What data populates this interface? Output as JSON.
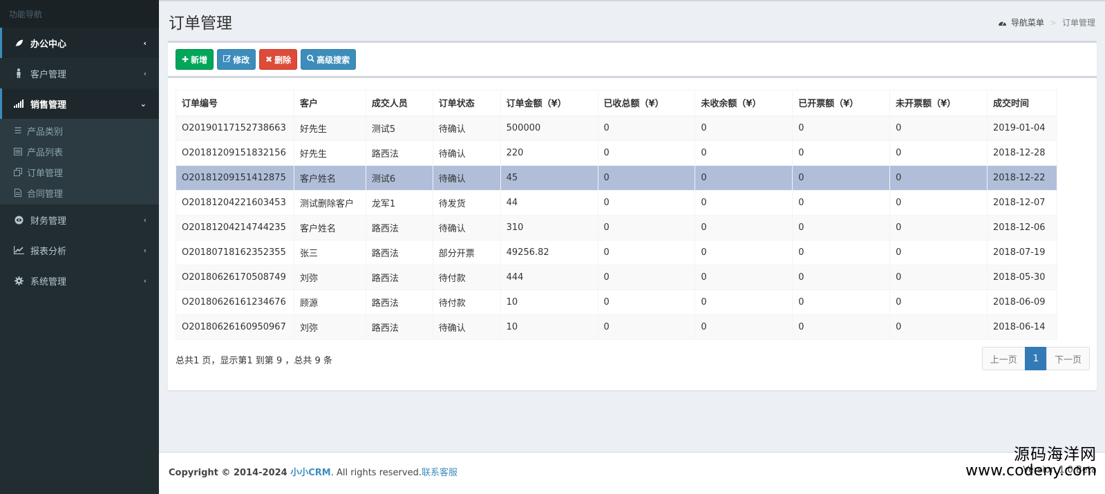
{
  "sidebar": {
    "header": "功能导航",
    "menu": [
      {
        "label": "办公中心",
        "icon": "leaf-icon",
        "chevron": "‹"
      },
      {
        "label": "客户管理",
        "icon": "male-icon",
        "chevron": "‹"
      },
      {
        "label": "销售管理",
        "icon": "signal-icon",
        "chevron": "⌄"
      },
      {
        "label": "财务管理",
        "icon": "eye-icon",
        "chevron": "‹"
      },
      {
        "label": "报表分析",
        "icon": "line-chart-icon",
        "chevron": "‹"
      },
      {
        "label": "系统管理",
        "icon": "gear-icon",
        "chevron": "‹"
      }
    ],
    "submenu": [
      {
        "label": "产品类别",
        "icon": "bars-icon"
      },
      {
        "label": "产品列表",
        "icon": "list-alt-icon"
      },
      {
        "label": "订单管理",
        "icon": "clone-icon"
      },
      {
        "label": "合同管理",
        "icon": "file-icon"
      }
    ]
  },
  "header": {
    "title": "订单管理",
    "breadcrumb": {
      "home": "导航菜单",
      "current": "订单管理"
    }
  },
  "toolbar": {
    "add": "新增",
    "edit": "修改",
    "delete": "删除",
    "search": "高级搜索"
  },
  "table": {
    "columns": [
      "订单编号",
      "客户",
      "成交人员",
      "订单状态",
      "订单金额（¥）",
      "已收总额（¥）",
      "未收余额（¥）",
      "已开票额（¥）",
      "未开票额（¥）",
      "成交时间"
    ],
    "rows": [
      [
        "O20190117152738663",
        "好先生",
        "测试5",
        "待确认",
        "500000",
        "0",
        "0",
        "0",
        "0",
        "2019-01-04"
      ],
      [
        "O20181209151832156",
        "好先生",
        "路西法",
        "待确认",
        "220",
        "0",
        "0",
        "0",
        "0",
        "2018-12-28"
      ],
      [
        "O20181209151412875",
        "客户姓名",
        "测试6",
        "待确认",
        "45",
        "0",
        "0",
        "0",
        "0",
        "2018-12-22"
      ],
      [
        "O20181204221603453",
        "测试删除客户",
        "龙军1",
        "待发货",
        "44",
        "0",
        "0",
        "0",
        "0",
        "2018-12-07"
      ],
      [
        "O20181204214744235",
        "客户姓名",
        "路西法",
        "待确认",
        "310",
        "0",
        "0",
        "0",
        "0",
        "2018-12-06"
      ],
      [
        "O20180718162352355",
        "张三",
        "路西法",
        "部分开票",
        "49256.82",
        "0",
        "0",
        "0",
        "0",
        "2018-07-19"
      ],
      [
        "O20180626170508749",
        "刘弥",
        "路西法",
        "待付款",
        "444",
        "0",
        "0",
        "0",
        "0",
        "2018-05-30"
      ],
      [
        "O20180626161234676",
        "顾源",
        "路西法",
        "待付款",
        "10",
        "0",
        "0",
        "0",
        "0",
        "2018-06-09"
      ],
      [
        "O20180626160950967",
        "刘弥",
        "路西法",
        "待确认",
        "10",
        "0",
        "0",
        "0",
        "0",
        "2018-06-14"
      ]
    ],
    "selected_row": 2
  },
  "pagination": {
    "info": "总共1 页，显示第1 到第 9 ，总共 9 条",
    "prev": "上一页",
    "current": "1",
    "next": "下一页"
  },
  "footer": {
    "copyright_prefix": "Copyright © 2014-2024 ",
    "brand": "小小CRM",
    "rights": ". All rights reserved.",
    "contact": "联系客服",
    "version": "Version 1.0 Beta"
  },
  "watermark": {
    "line1": "源码海洋网",
    "line2": "www.codeny.com"
  },
  "colors": {
    "sidebar_bg": "#222d32",
    "accent": "#3c8dbc",
    "success": "#00a65a",
    "danger": "#dd4b39",
    "selected_row": "#b0bed9"
  }
}
